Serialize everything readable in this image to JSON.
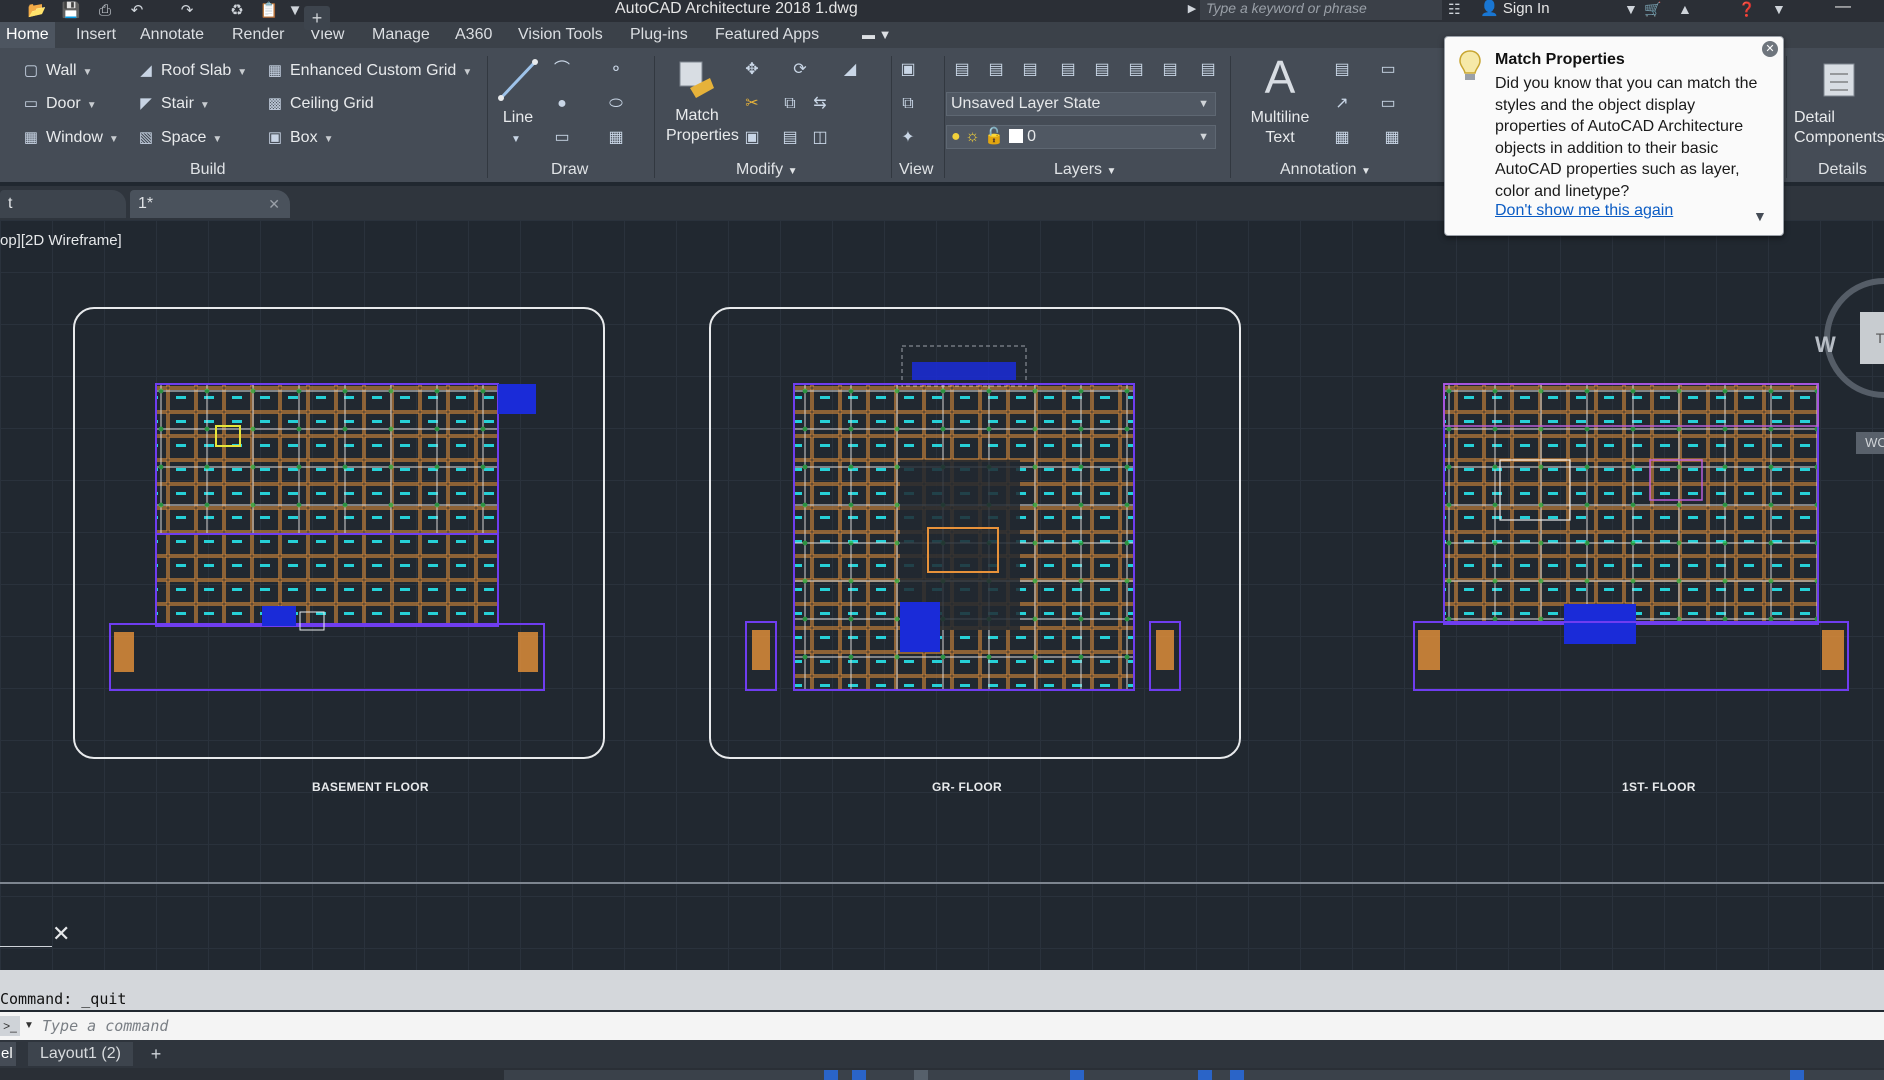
{
  "window": {
    "title": "AutoCAD Architecture 2018    1.dwg",
    "search_placeholder": "Type a keyword or phrase",
    "sign_in": "Sign In"
  },
  "ribbon_tabs": [
    "Home",
    "Insert",
    "Annotate",
    "Render",
    "View",
    "Manage",
    "A360",
    "Vision Tools",
    "Plug-ins",
    "Featured Apps"
  ],
  "build": {
    "wall": "Wall",
    "door": "Door",
    "window": "Window",
    "roof_slab": "Roof Slab",
    "stair": "Stair",
    "space": "Space",
    "enhanced_custom_grid": "Enhanced Custom Grid",
    "ceiling_grid": "Ceiling Grid",
    "box": "Box",
    "title": "Build"
  },
  "draw": {
    "line": "Line",
    "title": "Draw"
  },
  "modify": {
    "match_line1": "Match",
    "match_line2": "Properties",
    "title": "Modify"
  },
  "view": {
    "title": "View"
  },
  "layers": {
    "layer_state": "Unsaved Layer State",
    "current_layer": "0",
    "title": "Layers"
  },
  "annotation": {
    "mtext_line1": "Multiline",
    "mtext_line2": "Text",
    "title": "Annotation"
  },
  "details": {
    "detail_line1": "Detail",
    "detail_line2": "Components",
    "title": "Details"
  },
  "file_tabs": {
    "start_stub": "t",
    "active": "1*"
  },
  "viewport": {
    "label": "op][2D Wireframe]",
    "floors": [
      "BASEMENT FLOOR",
      "GR- FLOOR",
      "1ST- FLOOR"
    ],
    "viewcube_w": "W",
    "viewcube_face": "T",
    "wcs": "WC"
  },
  "tooltip": {
    "title": "Match Properties",
    "body": "Did you know that you can match the styles and the object display properties of AutoCAD Architecture objects in addition to their basic AutoCAD properties such as layer, color and linetype?",
    "link": "Don't show me this again"
  },
  "command": {
    "last": "Command: _quit",
    "placeholder": "Type a command"
  },
  "layout_tabs": {
    "model_stub": "el",
    "layout1": "Layout1 (2)"
  }
}
